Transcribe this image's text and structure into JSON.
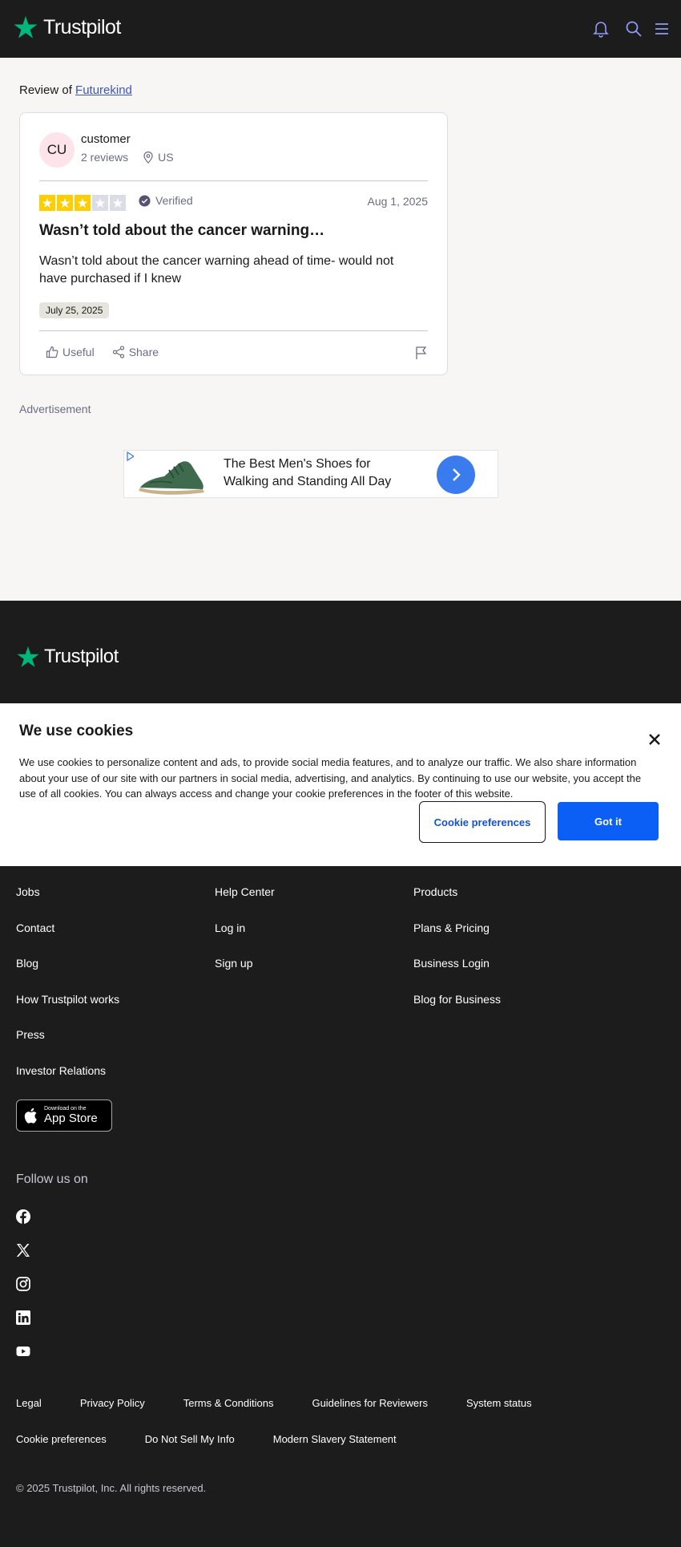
{
  "header": {
    "brand": "Trustpilot",
    "icons": [
      "bell-icon",
      "search-icon",
      "menu-icon"
    ]
  },
  "colors": {
    "brand_green": "#00b67a",
    "star_yellow": "#ffce00",
    "star_empty": "#dcdce6",
    "link_blue": "#3c57bc",
    "primary_blue": "#0b5ff5",
    "footer_bg": "#1c1c1c",
    "page_bg": "#f7f6f4"
  },
  "review_page": {
    "review_of_prefix": "Review of",
    "company": "Futurekind"
  },
  "review": {
    "avatar_initials": "CU",
    "reviewer_name": "customer",
    "reviewer_count": "2 reviews",
    "reviewer_country": "US",
    "rating": 3,
    "rating_max": 5,
    "verified_label": "Verified",
    "date": "Aug 1, 2025",
    "title": "Wasn’t told about the cancer warning…",
    "body": "Wasn’t told about the cancer warning ahead of time- would not have purchased if I knew",
    "experience_date": "July 25, 2025",
    "useful_label": "Useful",
    "share_label": "Share"
  },
  "advertisement": {
    "label": "Advertisement",
    "headline": "The Best Men's Shoes for Walking and Standing All Day"
  },
  "cookie_banner": {
    "title": "We use cookies",
    "text": "We use cookies to personalize content and ads, to provide social media features, and to analyze our traffic. We also share information about your use of our site with our partners in social media, advertising, and analytics. By continuing to use our website, you accept the use of all cookies. You can always access and change your cookie preferences in the footer of this website.",
    "preferences_label": "Cookie preferences",
    "accept_label": "Got it"
  },
  "footer": {
    "brand": "Trustpilot",
    "col1": [
      "Jobs",
      "Contact",
      "Blog",
      "How Trustpilot works",
      "Press",
      "Investor Relations"
    ],
    "col2": [
      "Help Center",
      "Log in",
      "Sign up"
    ],
    "col3": [
      "Products",
      "Plans & Pricing",
      "Business Login",
      "Blog for Business"
    ],
    "appstore_small": "Download on the",
    "appstore_big": "App Store",
    "follow_label": "Follow us on",
    "social": [
      "facebook-icon",
      "x-icon",
      "instagram-icon",
      "linkedin-icon",
      "youtube-icon"
    ],
    "legal_row1": [
      "Legal",
      "Privacy Policy",
      "Terms & Conditions",
      "Guidelines for Reviewers",
      "System status"
    ],
    "legal_row2": [
      "Cookie preferences",
      "Do Not Sell My Info",
      "Modern Slavery Statement"
    ],
    "copyright": "© 2025 Trustpilot, Inc. All rights reserved."
  }
}
